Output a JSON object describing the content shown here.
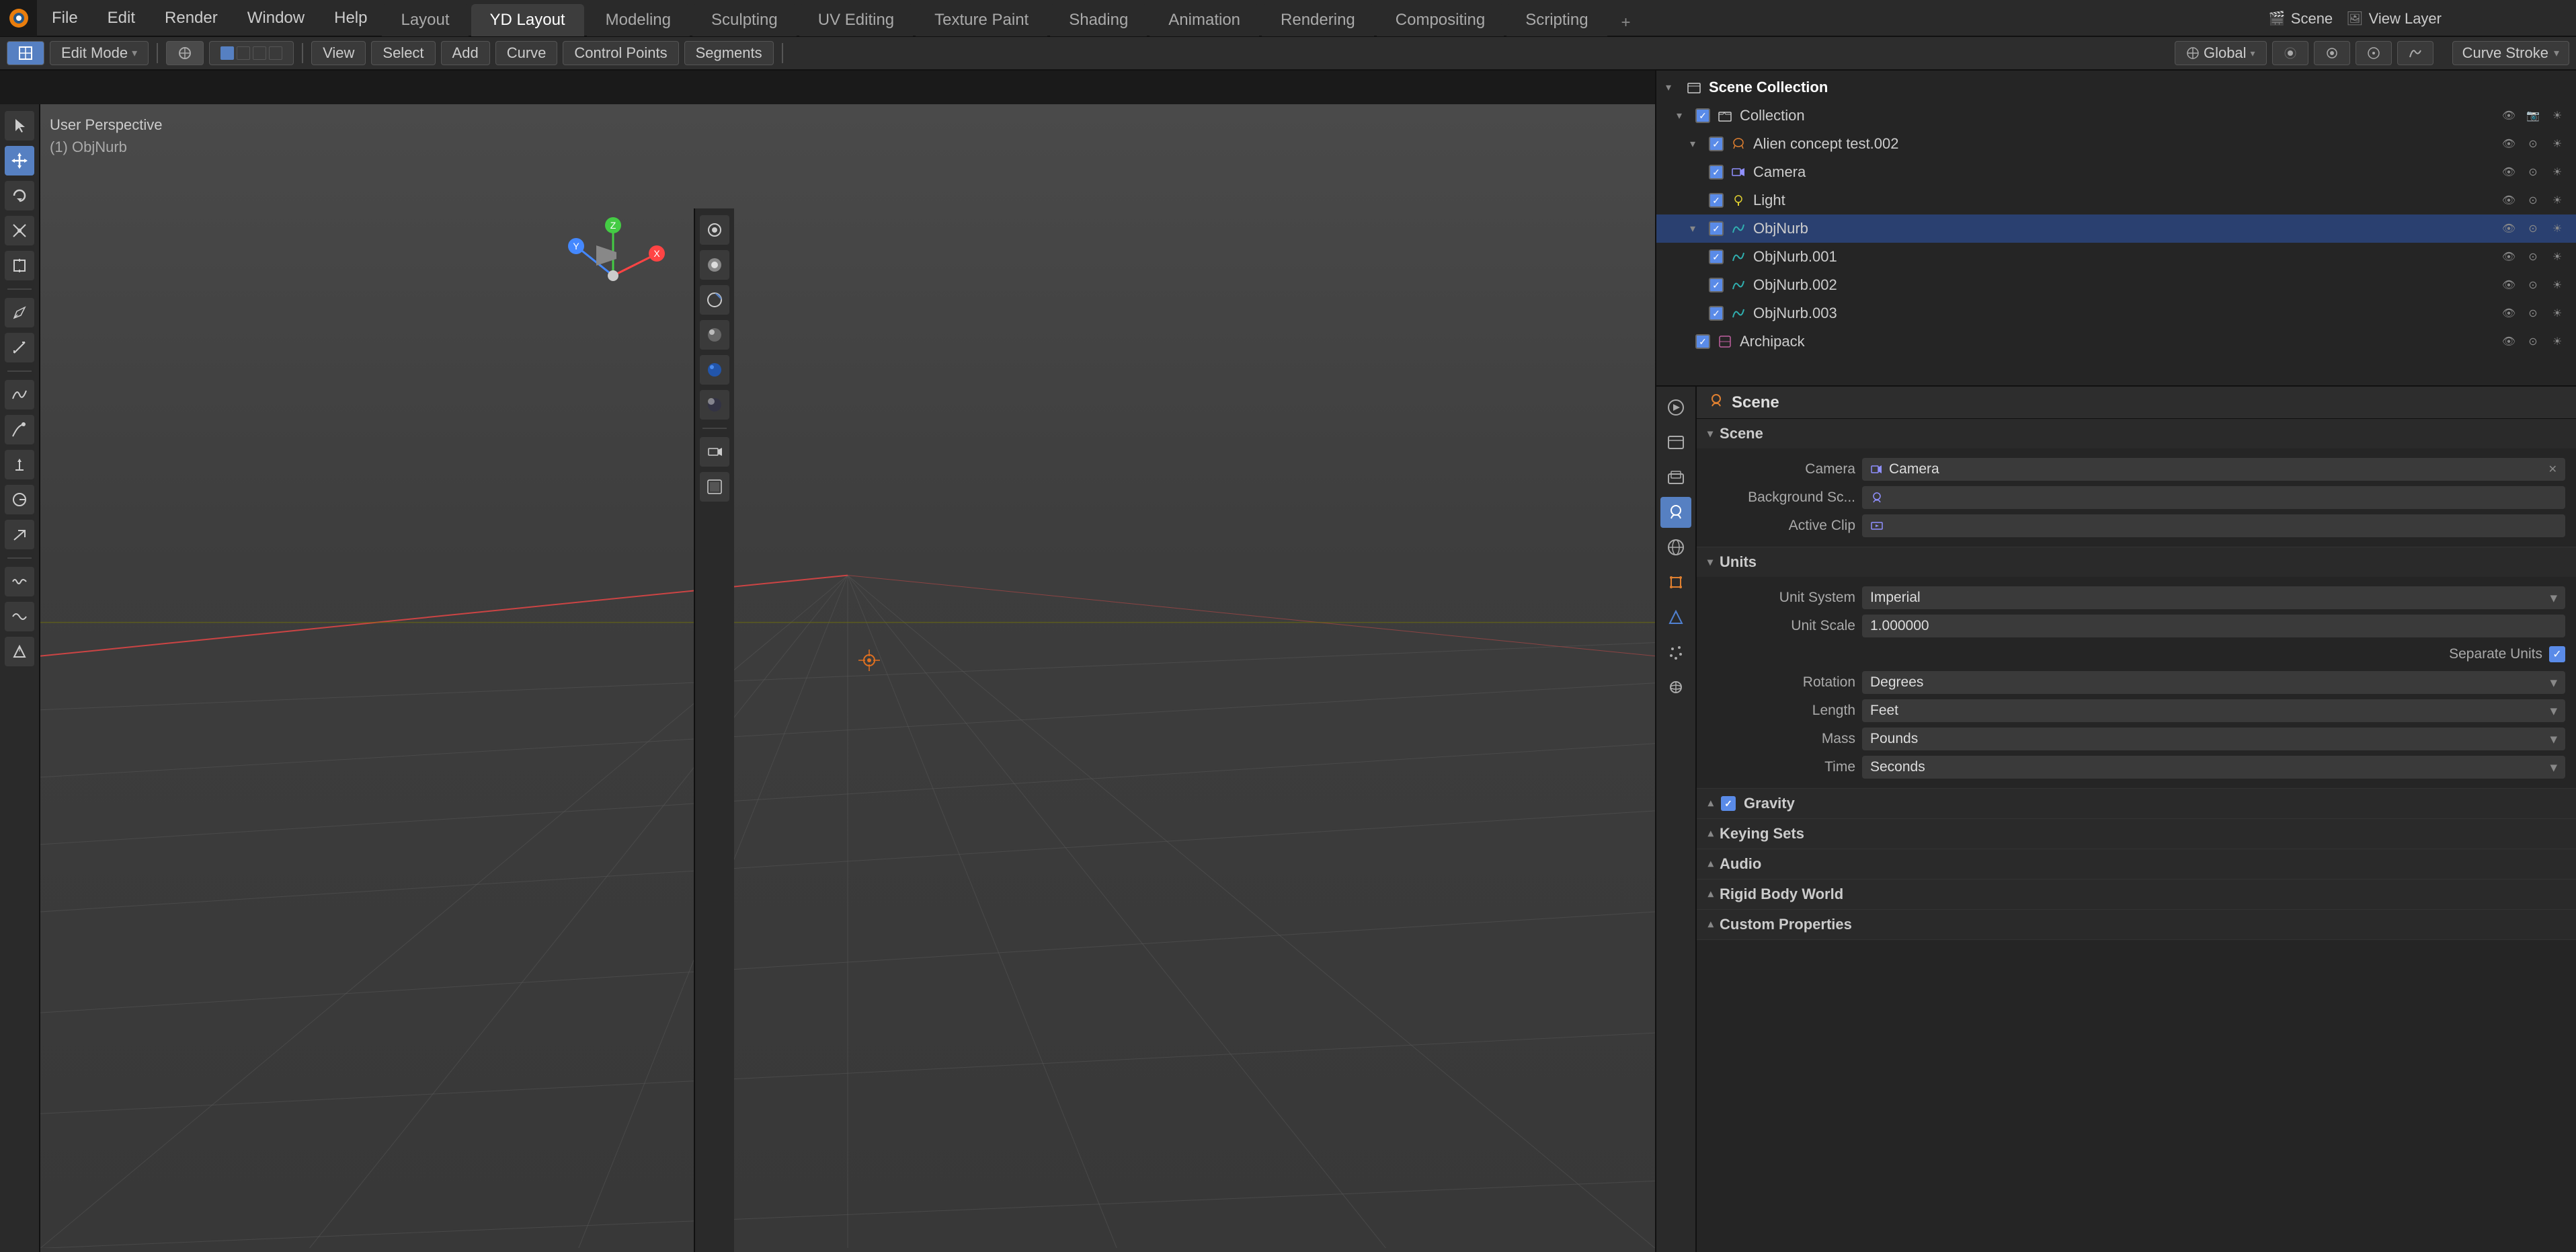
{
  "app": {
    "title": "Blender",
    "logo": "🔷"
  },
  "top_menu": {
    "items": [
      "File",
      "Edit",
      "Render",
      "Window",
      "Help"
    ]
  },
  "workspace_tabs": {
    "tabs": [
      "Layout",
      "YD Layout",
      "Modeling",
      "Sculpting",
      "UV Editing",
      "Texture Paint",
      "Shading",
      "Animation",
      "Rendering",
      "Compositing",
      "Scripting"
    ],
    "active": "YD Layout",
    "plus_label": "+"
  },
  "header_bar": {
    "mode_dropdown": "Edit Mode",
    "view_btn": "View",
    "select_btn": "Select",
    "add_btn": "Add",
    "curve_btn": "Curve",
    "control_points_btn": "Control Points",
    "segments_btn": "Segments",
    "transform_icon": "⟁",
    "global_label": "Global",
    "proportional_icon": "⊙",
    "snap_icon": "🧲"
  },
  "mode_bar": {
    "view_btn": "View",
    "select_btn": "Select",
    "add_btn": "Add",
    "curve_btn": "Curve",
    "control_points_btn": "Control Points",
    "segments_btn": "Segments"
  },
  "viewport": {
    "info_line1": "User Perspective",
    "info_line2": "(1) ObjNurb",
    "stroke_type": "Curve Stroke"
  },
  "outliner": {
    "title": "Scene Collection",
    "items": [
      {
        "level": 0,
        "expand": "▾",
        "icon": "📁",
        "icon_class": "yellow",
        "label": "Collection",
        "checked": true
      },
      {
        "level": 1,
        "expand": "▾",
        "icon": "👽",
        "icon_class": "orange",
        "label": "Alien concept test.002",
        "checked": true
      },
      {
        "level": 1,
        "expand": " ",
        "icon": "📷",
        "icon_class": "blue",
        "label": "Camera",
        "checked": true
      },
      {
        "level": 1,
        "expand": " ",
        "icon": "💡",
        "icon_class": "yellow",
        "label": "Light",
        "checked": true
      },
      {
        "level": 1,
        "expand": "▾",
        "icon": "〰",
        "icon_class": "teal",
        "label": "ObjNurb",
        "checked": true,
        "selected": true
      },
      {
        "level": 1,
        "expand": " ",
        "icon": "〰",
        "icon_class": "teal",
        "label": "ObjNurb.001",
        "checked": true
      },
      {
        "level": 1,
        "expand": " ",
        "icon": "〰",
        "icon_class": "teal",
        "label": "ObjNurb.002",
        "checked": true
      },
      {
        "level": 1,
        "expand": " ",
        "icon": "〰",
        "icon_class": "teal",
        "label": "ObjNurb.003",
        "checked": true
      },
      {
        "level": 0,
        "expand": " ",
        "icon": "📦",
        "icon_class": "purple",
        "label": "Archipack",
        "checked": true
      }
    ]
  },
  "properties": {
    "header_icon": "🎬",
    "header_title": "Scene",
    "sections": [
      {
        "id": "scene",
        "label": "Scene",
        "expanded": true,
        "rows": [
          {
            "label": "Camera",
            "value": "Camera",
            "type": "object",
            "icon": "📷"
          },
          {
            "label": "Background Sc...",
            "value": "",
            "type": "icon_field"
          },
          {
            "label": "Active Clip",
            "value": "",
            "type": "icon_field"
          }
        ]
      },
      {
        "id": "units",
        "label": "Units",
        "expanded": true,
        "rows": [
          {
            "label": "Unit System",
            "value": "Imperial",
            "type": "dropdown"
          },
          {
            "label": "Unit Scale",
            "value": "1.000000",
            "type": "number"
          },
          {
            "label": "Separate Units",
            "value": true,
            "type": "checkbox"
          },
          {
            "label": "Rotation",
            "value": "Degrees",
            "type": "dropdown"
          },
          {
            "label": "Length",
            "value": "Feet",
            "type": "dropdown"
          },
          {
            "label": "Mass",
            "value": "Pounds",
            "type": "dropdown"
          },
          {
            "label": "Time",
            "value": "Seconds",
            "type": "dropdown"
          }
        ]
      },
      {
        "id": "gravity",
        "label": "Gravity",
        "expanded": false,
        "checkbox": true
      },
      {
        "id": "keying_sets",
        "label": "Keying Sets",
        "expanded": false
      },
      {
        "id": "audio",
        "label": "Audio",
        "expanded": false
      },
      {
        "id": "rigid_body_world",
        "label": "Rigid Body World",
        "expanded": false
      },
      {
        "id": "custom_properties",
        "label": "Custom Properties",
        "expanded": false
      }
    ]
  },
  "prop_sidebar_icons": [
    "≡",
    "🎬",
    "🌍",
    "🎥",
    "🌟",
    "🔧",
    "🔵",
    "🟢",
    "🌀",
    "🏃"
  ],
  "left_toolbar_icons": [
    {
      "name": "cursor",
      "symbol": "⊕",
      "active": false
    },
    {
      "name": "move",
      "symbol": "✦",
      "active": true
    },
    {
      "name": "rotate",
      "symbol": "↺",
      "active": false
    },
    {
      "name": "scale",
      "symbol": "⤡",
      "active": false
    },
    {
      "name": "transform",
      "symbol": "⊞",
      "active": false
    },
    {
      "name": "annotate",
      "symbol": "✏",
      "active": false
    },
    {
      "name": "measure",
      "symbol": "📏",
      "active": false
    },
    {
      "name": "add-curve",
      "symbol": "〜",
      "active": false
    },
    {
      "name": "draw",
      "symbol": "✒",
      "active": false
    },
    {
      "name": "extrude",
      "symbol": "↑",
      "active": false
    },
    {
      "name": "radius",
      "symbol": "◯",
      "active": false
    },
    {
      "name": "tilt",
      "symbol": "↗",
      "active": false
    },
    {
      "name": "randomize",
      "symbol": "≋",
      "active": false
    },
    {
      "name": "smooth",
      "symbol": "〰",
      "active": false
    },
    {
      "name": "shrink",
      "symbol": "⬡",
      "active": false
    }
  ],
  "vp_right_toolbar_icons": [
    {
      "name": "view",
      "symbol": "👁"
    },
    {
      "name": "render-mode",
      "symbol": "●"
    },
    {
      "name": "transform-orient",
      "symbol": "⊕"
    },
    {
      "name": "viewport-shading",
      "symbol": "◑"
    },
    {
      "name": "overlay",
      "symbol": "⊙"
    },
    {
      "name": "camera",
      "symbol": "📷"
    },
    {
      "name": "render-preview",
      "symbol": "🖼"
    }
  ],
  "scene_name": "Scene",
  "view_layer_name": "View Layer"
}
